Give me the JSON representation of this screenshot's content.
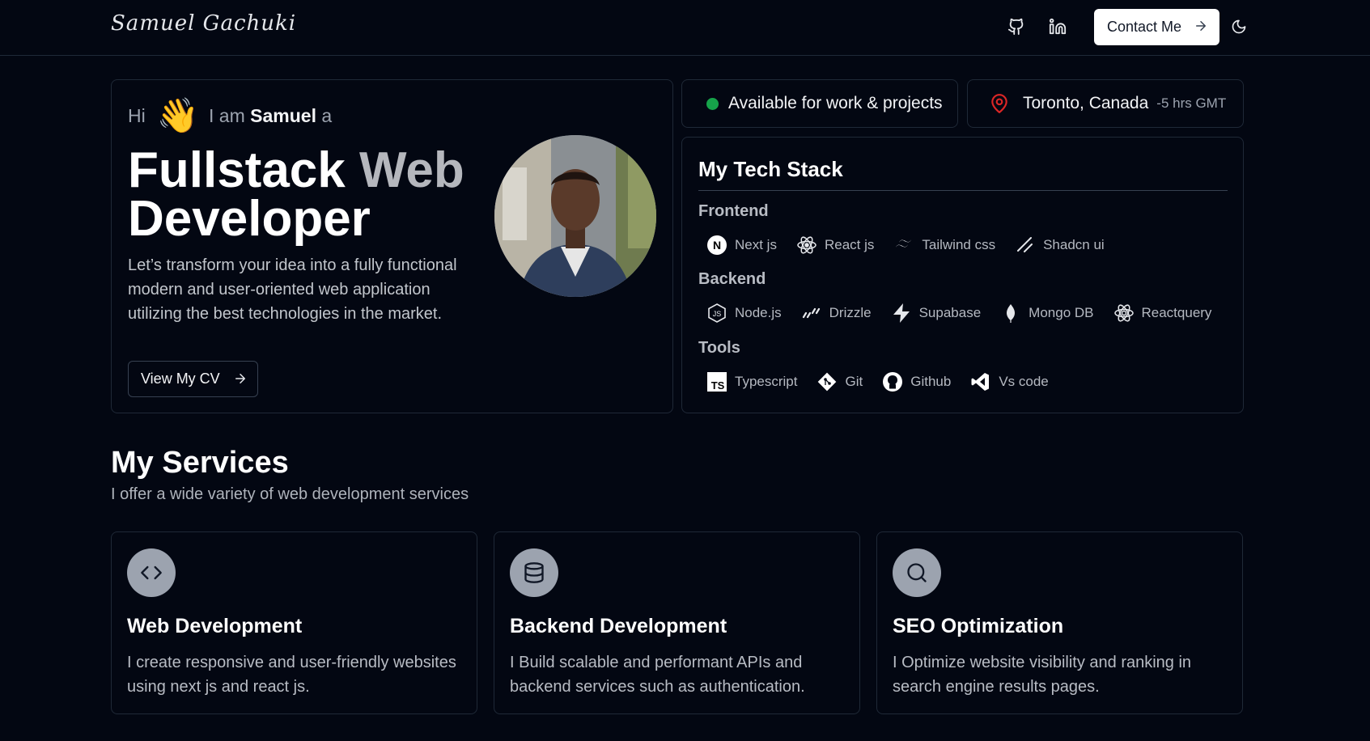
{
  "brand": {
    "logo": "Samuel Gachuki"
  },
  "nav": {
    "github_icon": "github-icon",
    "linkedin_icon": "linkedin-icon",
    "contact_label": "Contact Me",
    "theme_icon": "moon-icon"
  },
  "hero": {
    "hi": "Hi",
    "wave": "👋",
    "i_am": "I am",
    "name": "Samuel",
    "a": "a",
    "title_part1": "Fullstack",
    "title_part2": "Web",
    "title_part3": "Developer",
    "description": "Let’s transform your idea into a fully functional modern and user-oriented web application utilizing the best technologies in the market.",
    "cv_label": "View My CV"
  },
  "status": {
    "text": "Available for work & projects",
    "color": "#16a34a"
  },
  "location": {
    "city": "Toronto, Canada",
    "timezone": "-5 hrs GMT",
    "pin_color": "#dc2626"
  },
  "tech_stack": {
    "title": "My Tech Stack",
    "frontend_label": "Frontend",
    "frontend": [
      {
        "name": "Next js",
        "icon": "nextjs-icon"
      },
      {
        "name": "React js",
        "icon": "react-icon"
      },
      {
        "name": "Tailwind css",
        "icon": "tailwind-icon"
      },
      {
        "name": "Shadcn ui",
        "icon": "shadcn-icon"
      }
    ],
    "backend_label": "Backend",
    "backend": [
      {
        "name": "Node.js",
        "icon": "nodejs-icon"
      },
      {
        "name": "Drizzle",
        "icon": "drizzle-icon"
      },
      {
        "name": "Supabase",
        "icon": "supabase-icon"
      },
      {
        "name": "Mongo DB",
        "icon": "mongodb-icon"
      },
      {
        "name": "Reactquery",
        "icon": "reactquery-icon"
      }
    ],
    "tools_label": "Tools",
    "tools": [
      {
        "name": "Typescript",
        "icon": "typescript-icon"
      },
      {
        "name": "Git",
        "icon": "git-icon"
      },
      {
        "name": "Github",
        "icon": "github-icon"
      },
      {
        "name": "Vs code",
        "icon": "vscode-icon"
      }
    ]
  },
  "services": {
    "title": "My Services",
    "subtitle": "I offer a wide variety of web development services",
    "items": [
      {
        "title": "Web Development",
        "description": "I create responsive and user-friendly websites using next js and react js.",
        "icon": "code-icon"
      },
      {
        "title": "Backend Development",
        "description": "I Build scalable and performant APIs and backend services such as authentication.",
        "icon": "database-icon"
      },
      {
        "title": "SEO Optimization",
        "description": "I Optimize website visibility and ranking in search engine results pages.",
        "icon": "search-icon"
      }
    ]
  }
}
